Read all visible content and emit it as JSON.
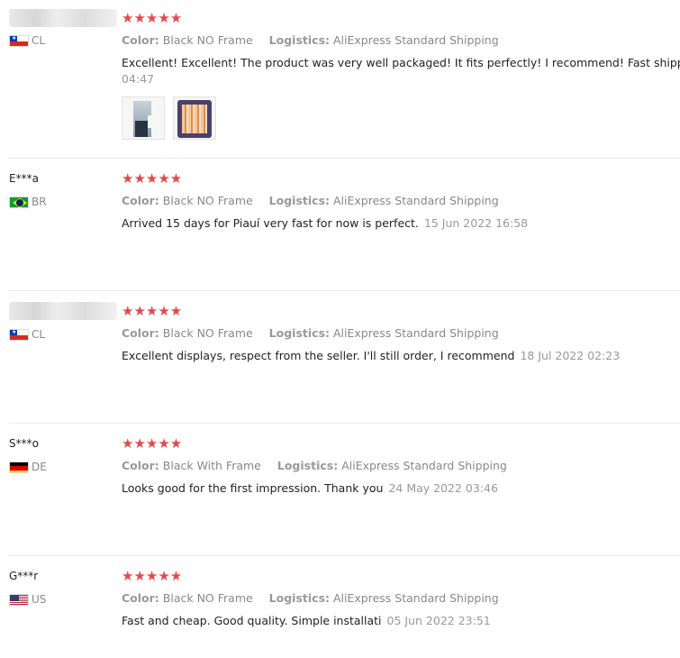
{
  "rating_stars": "★★★★★",
  "reviews": [
    {
      "user": "",
      "country": "CL",
      "flag": "cl-flag",
      "color_label": "Color:",
      "color_value": "Black NO Frame",
      "logistics_label": "Logistics:",
      "logistics_value": "AliExpress Standard Shipping",
      "text": "Excellent! Excellent! The product was very well packaged! It fits perfectly! I recommend! Fast shipping!",
      "date": "04:47",
      "photos": [
        "product-photo-1",
        "product-photo-2"
      ]
    },
    {
      "user": "E***a",
      "country": "BR",
      "flag": "br-flag",
      "color_label": "Color:",
      "color_value": "Black NO Frame",
      "logistics_label": "Logistics:",
      "logistics_value": "AliExpress Standard Shipping",
      "text": "Arrived 15 days for Piauí very fast for now is perfect.",
      "date": "15 Jun 2022 16:58"
    },
    {
      "user": "",
      "country": "CL",
      "flag": "cl-flag",
      "color_label": "Color:",
      "color_value": "Black NO Frame",
      "logistics_label": "Logistics:",
      "logistics_value": "AliExpress Standard Shipping",
      "text": "Excellent displays, respect from the seller. I'll still order, I recommend",
      "date": "18 Jul 2022 02:23"
    },
    {
      "user": "S***o",
      "country": "DE",
      "flag": "de-flag",
      "color_label": "Color:",
      "color_value": "Black With Frame",
      "logistics_label": "Logistics:",
      "logistics_value": "AliExpress Standard Shipping",
      "text": "Looks good for the first impression. Thank you",
      "date": "24 May 2022 03:46"
    },
    {
      "user": "G***r",
      "country": "US",
      "flag": "us-flag",
      "color_label": "Color:",
      "color_value": "Black NO Frame",
      "logistics_label": "Logistics:",
      "logistics_value": "AliExpress Standard Shipping",
      "text": "Fast and cheap. Good quality. Simple installati",
      "date": "05 Jun 2022 23:51"
    }
  ]
}
